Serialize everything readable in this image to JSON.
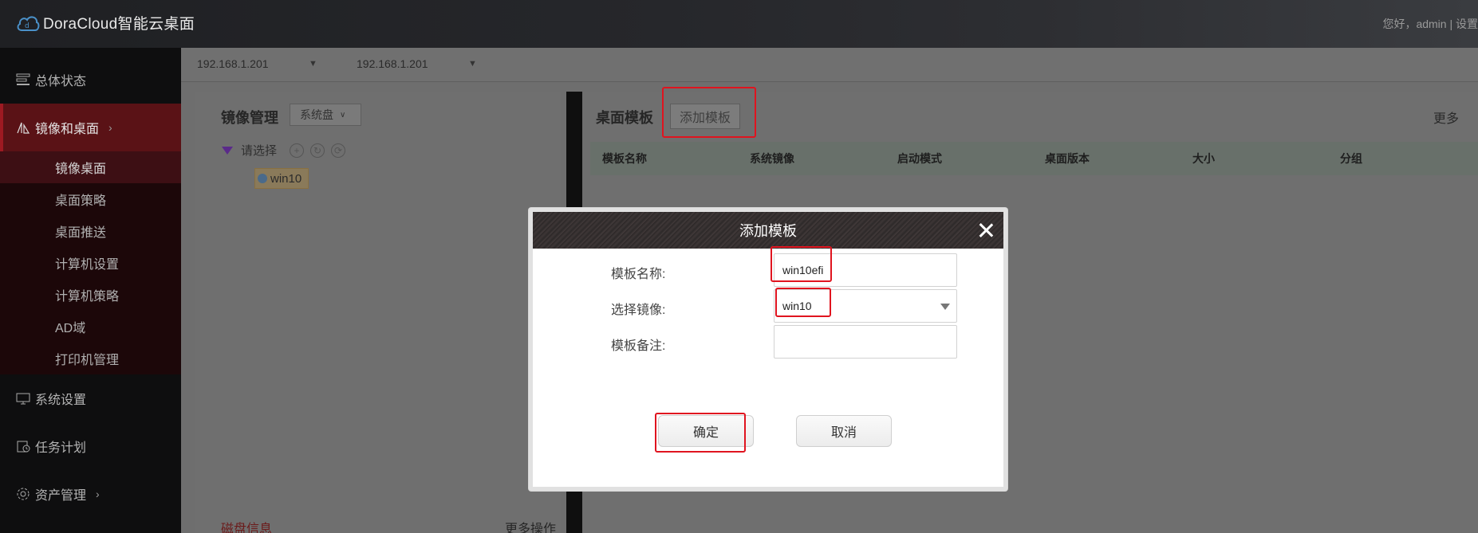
{
  "app": {
    "logo_text": "DoraCloud智能云桌面",
    "greeting": "您好，admin | 设置"
  },
  "sidebar": {
    "items": [
      {
        "label": "总体状态",
        "icon": "dashboard-icon"
      },
      {
        "label": "镜像和桌面",
        "icon": "images-icon",
        "active": true
      },
      {
        "label": "系统设置",
        "icon": "monitor-icon"
      },
      {
        "label": "任务计划",
        "icon": "schedule-icon"
      },
      {
        "label": "资产管理",
        "icon": "gear-icon"
      }
    ],
    "subitems": [
      "镜像桌面",
      "桌面策略",
      "桌面推送",
      "计算机设置",
      "计算机策略",
      "AD域",
      "打印机管理"
    ],
    "selected_subitem": "镜像桌面"
  },
  "ipbar": {
    "host1": "192.168.1.201",
    "host2": "192.168.1.201"
  },
  "image_panel": {
    "title": "镜像管理",
    "disk_select": "系统盘",
    "tree_root": "请选择",
    "tree_node": "win10",
    "disk_info": "磁盘信息",
    "more_ops": "更多操作"
  },
  "template_panel": {
    "title": "桌面模板",
    "add_button": "添加模板",
    "more": "更多",
    "columns": [
      "模板名称",
      "系统镜像",
      "启动模式",
      "桌面版本",
      "大小",
      "分组"
    ]
  },
  "modal": {
    "title": "添加模板",
    "name_label": "模板名称:",
    "name_value": "win10efi",
    "image_label": "选择镜像:",
    "image_value": "win10",
    "note_label": "模板备注:",
    "note_value": "",
    "confirm": "确定",
    "cancel": "取消"
  },
  "colors": {
    "highlight": "#e0141f",
    "active_nav": "#5a1216"
  }
}
